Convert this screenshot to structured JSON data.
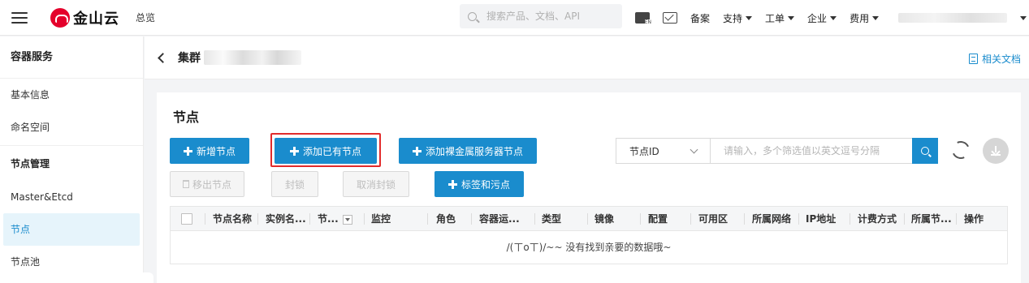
{
  "topbar": {
    "brand": "金山云",
    "overview": "总览",
    "search_placeholder": "搜索产品、文档、API",
    "links": [
      {
        "label": "备案",
        "dropdown": false
      },
      {
        "label": "支持",
        "dropdown": true
      },
      {
        "label": "工单",
        "dropdown": true
      },
      {
        "label": "企业",
        "dropdown": true
      },
      {
        "label": "费用",
        "dropdown": true
      }
    ]
  },
  "sidebar": {
    "title": "容器服务",
    "items": [
      "基本信息",
      "命名空间"
    ],
    "group": "节点管理",
    "group_items": [
      "Master&Etcd",
      "节点",
      "节点池"
    ],
    "active": "节点"
  },
  "crumb": {
    "cluster_label": "集群",
    "docs_label": "相关文档"
  },
  "panel": {
    "title": "节点",
    "buttons": {
      "add_node": "新增节点",
      "add_existing": "添加已有节点",
      "add_baremetal": "添加裸金属服务器节点",
      "remove_node": "移出节点",
      "cordon": "封锁",
      "uncordon": "取消封锁",
      "labels_taints": "标签和污点"
    },
    "filter": {
      "field": "节点ID",
      "placeholder": "请输入，多个筛选值以英文逗号分隔"
    },
    "table": {
      "columns": [
        "节点名称",
        "实例名...",
        "节...",
        "监控",
        "角色",
        "容器运...",
        "类型",
        "镜像",
        "配置",
        "可用区",
        "所属网络",
        "IP地址",
        "计费方式",
        "所属节...",
        "操作"
      ],
      "empty": "/(ㄒoㄒ)/~~ 没有找到亲要的数据哦~"
    }
  },
  "colors": {
    "primary": "#1a8ccd",
    "highlight": "#e22b2b",
    "brand": "#e4002b"
  }
}
